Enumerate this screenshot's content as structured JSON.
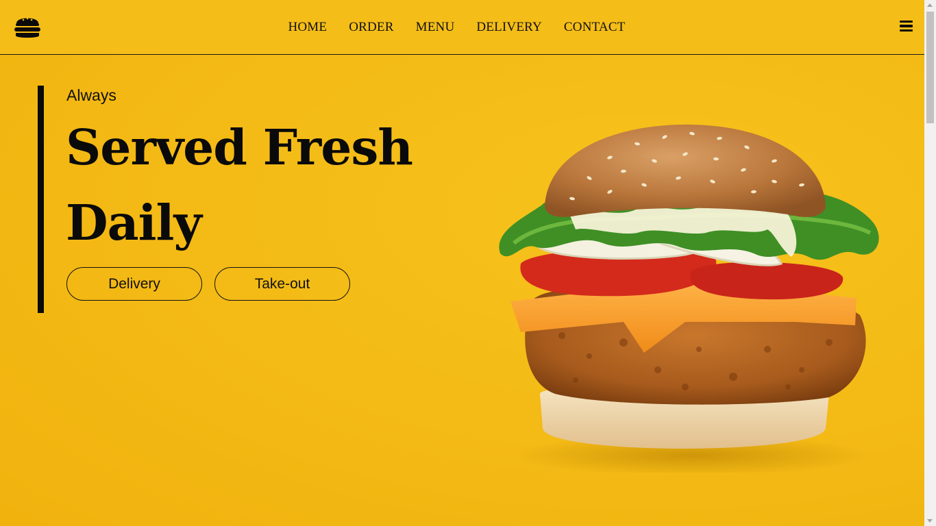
{
  "nav": {
    "items": [
      {
        "label": "HOME"
      },
      {
        "label": "ORDER"
      },
      {
        "label": "MENU"
      },
      {
        "label": "DELIVERY"
      },
      {
        "label": "CONTACT"
      }
    ]
  },
  "hero": {
    "kicker": "Always",
    "headline_line1": "Served Fresh",
    "headline_line2": "Daily",
    "buttons": {
      "delivery": "Delivery",
      "takeout": "Take-out"
    }
  },
  "icons": {
    "logo": "burger-icon",
    "menu": "hamburger-menu-icon"
  },
  "colors": {
    "background": "#f5bd18",
    "text": "#0a0a0a"
  }
}
